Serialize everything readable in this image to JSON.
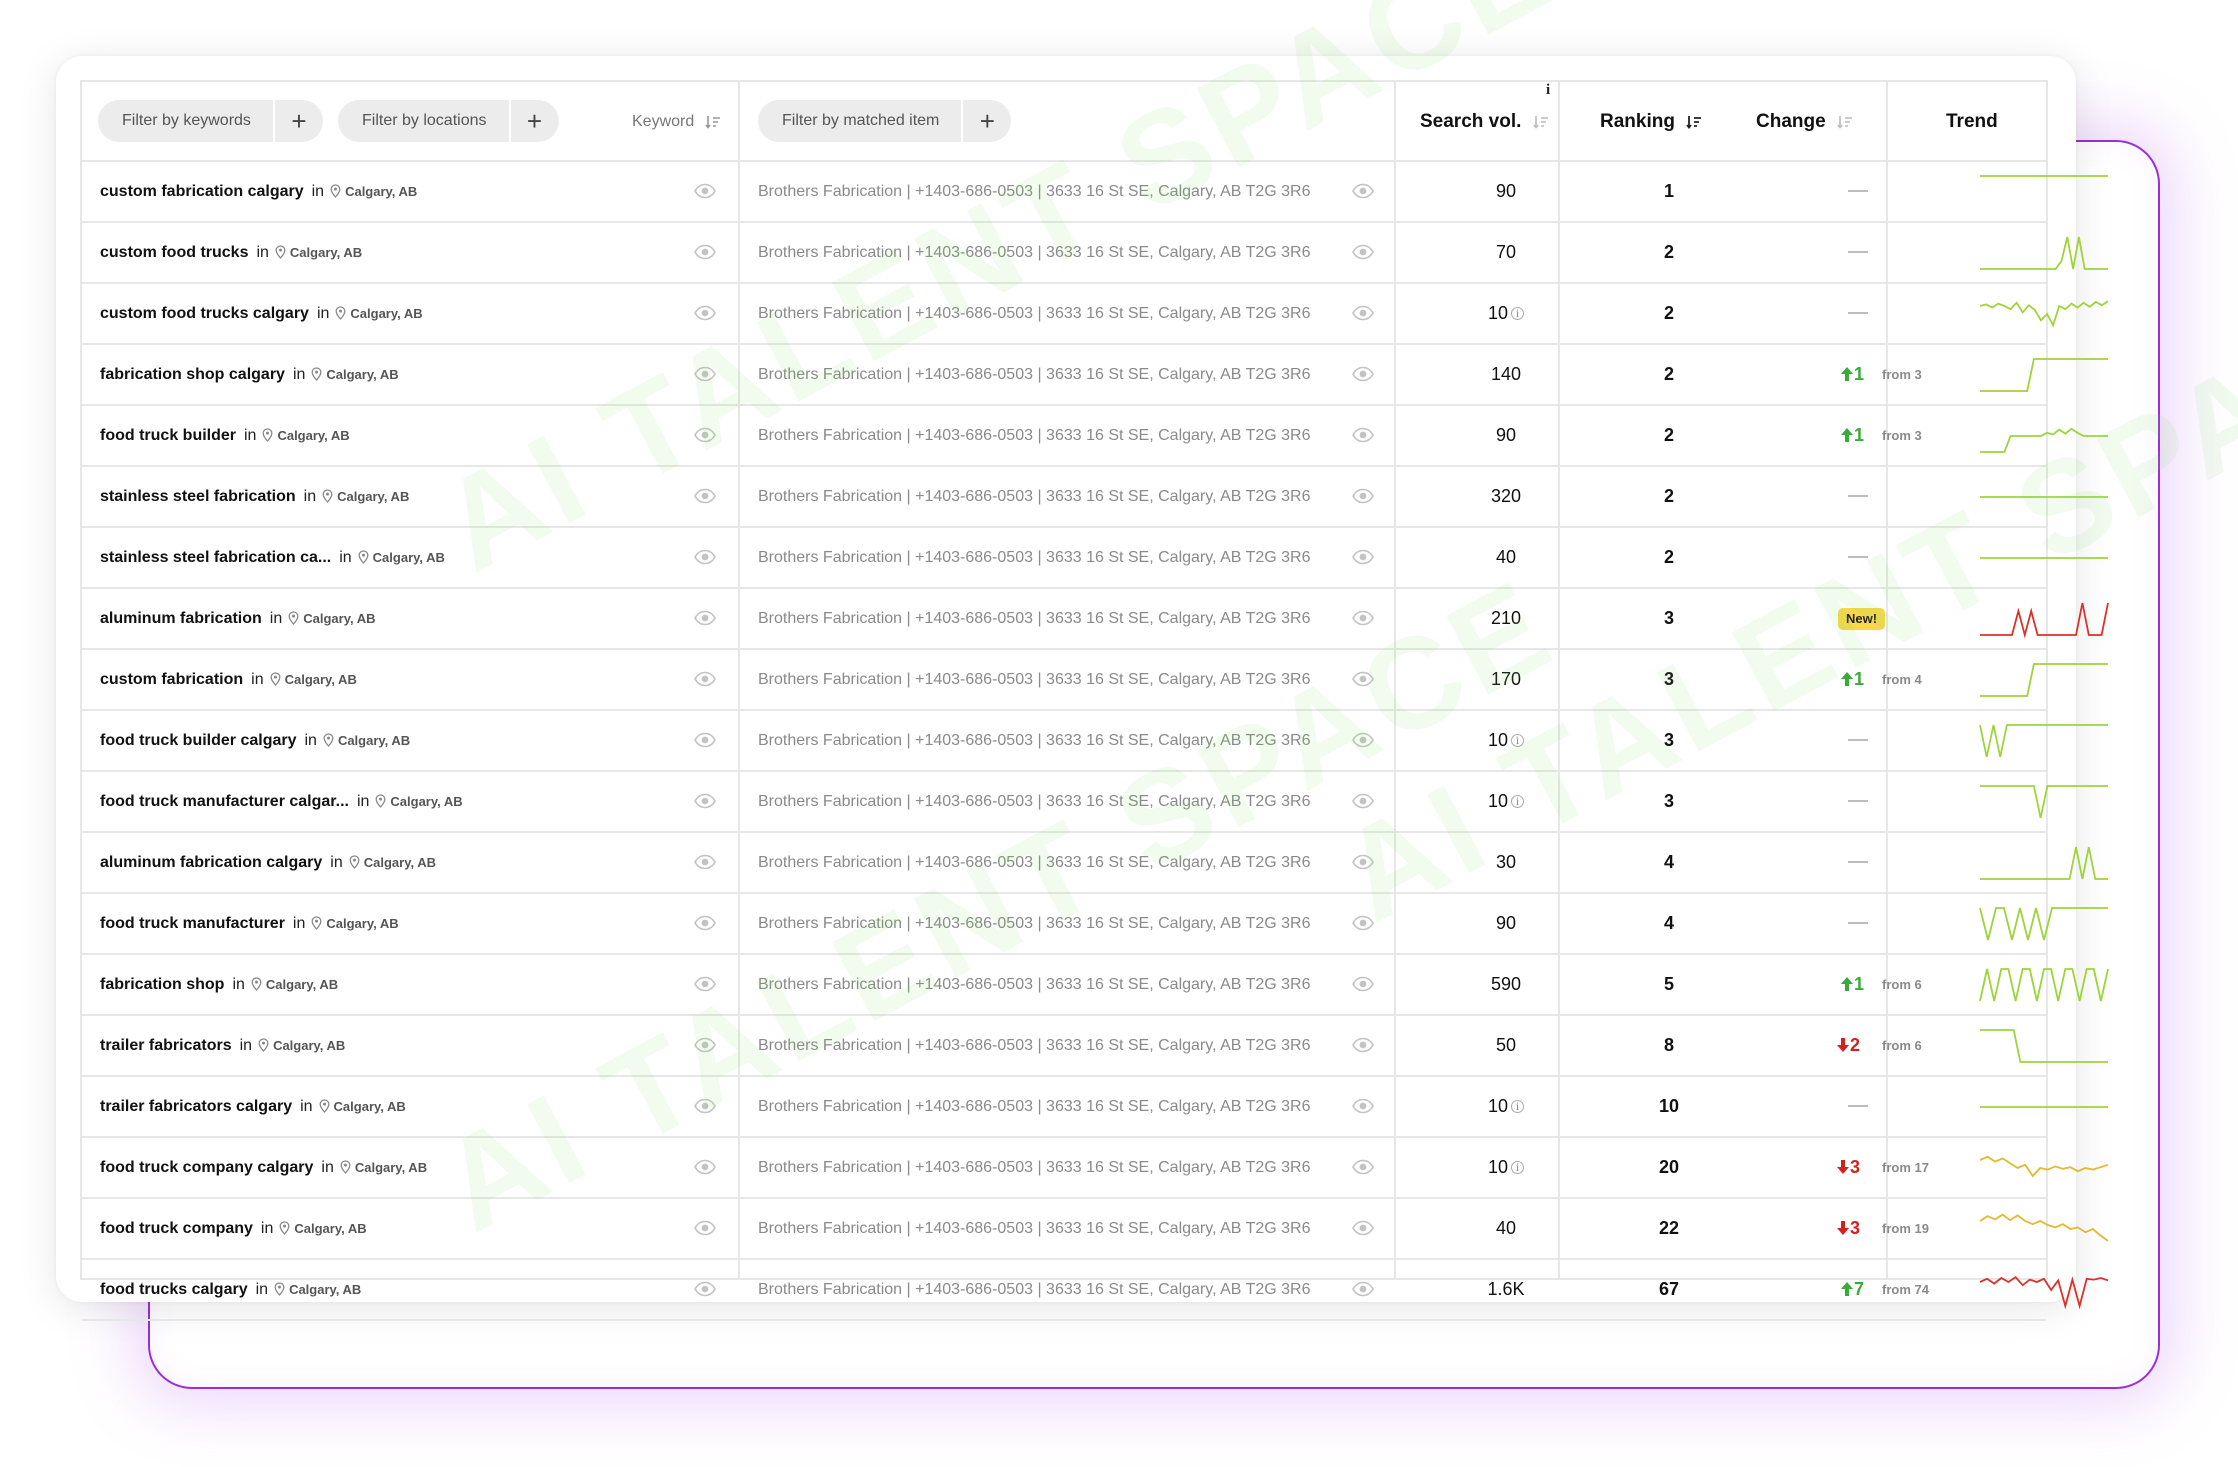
{
  "watermark_text": "AI TALENT SPACE",
  "filters": {
    "keywords_label": "Filter by keywords",
    "locations_label": "Filter by locations",
    "matched_label": "Filter by matched item",
    "add_symbol": "+"
  },
  "columns": {
    "keyword": "Keyword",
    "search_vol": "Search vol.",
    "info": "i",
    "ranking": "Ranking",
    "change": "Change",
    "trend": "Trend"
  },
  "in_word": "in",
  "colors": {
    "up": "#3aaa3a",
    "down": "#d62020",
    "trend_green": "#9dd43a",
    "trend_red": "#d9322a",
    "badge": "#f7d84a",
    "accent_border": "#9b2fd6"
  },
  "rows": [
    {
      "keyword": "custom fabrication calgary",
      "location": "Calgary, AB",
      "matched": "Brothers Fabrication | +1403-686-0503 | 3633 16 St SE, Calgary, AB T2G 3R6",
      "volume": "90",
      "vol_info": false,
      "ranking": "1",
      "change_type": "none",
      "change_value": "",
      "change_from": "",
      "trend_color": "green",
      "trend": [
        5,
        5,
        5,
        5,
        5,
        5,
        5,
        5,
        5,
        5,
        5,
        5,
        5,
        5,
        5,
        5,
        5,
        5,
        5,
        5
      ]
    },
    {
      "keyword": "custom food trucks",
      "location": "Calgary, AB",
      "matched": "Brothers Fabrication | +1403-686-0503 | 3633 16 St SE, Calgary, AB T2G 3R6",
      "volume": "70",
      "vol_info": false,
      "ranking": "2",
      "change_type": "none",
      "change_value": "",
      "change_from": "",
      "trend_color": "green",
      "trend": [
        1,
        1,
        1,
        1,
        1,
        1,
        1,
        1,
        1,
        1,
        1,
        1,
        1,
        1,
        2,
        5,
        1,
        5,
        1,
        1,
        1,
        1,
        1
      ]
    },
    {
      "keyword": "custom food trucks calgary",
      "location": "Calgary, AB",
      "matched": "Brothers Fabrication | +1403-686-0503 | 3633 16 St SE, Calgary, AB T2G 3R6",
      "volume": "10",
      "vol_info": true,
      "ranking": "2",
      "change_type": "none",
      "change_value": "",
      "change_from": "",
      "trend_color": "green",
      "trend": [
        4,
        4.2,
        3.8,
        4.3,
        4,
        3.6,
        4.4,
        3.2,
        4.1,
        3.5,
        2.2,
        3,
        1.6,
        4,
        3.6,
        4.3,
        3.8,
        4.4,
        3.9,
        4.5,
        4.1,
        4.6
      ]
    },
    {
      "keyword": "fabrication shop calgary",
      "location": "Calgary, AB",
      "matched": "Brothers Fabrication | +1403-686-0503 | 3633 16 St SE, Calgary, AB T2G 3R6",
      "volume": "140",
      "vol_info": false,
      "ranking": "2",
      "change_type": "up",
      "change_value": "1",
      "change_from": "from 3",
      "trend_color": "green",
      "trend": [
        1,
        1,
        1,
        1,
        1,
        1,
        1,
        1,
        5,
        5,
        5,
        5,
        5,
        5,
        5,
        5,
        5,
        5,
        5,
        5
      ]
    },
    {
      "keyword": "food truck builder",
      "location": "Calgary, AB",
      "matched": "Brothers Fabrication | +1403-686-0503 | 3633 16 St SE, Calgary, AB T2G 3R6",
      "volume": "90",
      "vol_info": false,
      "ranking": "2",
      "change_type": "up",
      "change_value": "1",
      "change_from": "from 3",
      "trend_color": "green",
      "trend": [
        1,
        1,
        1,
        1,
        1,
        3,
        3,
        3,
        3,
        3,
        3,
        3.4,
        3.2,
        3.8,
        3.3,
        3.9,
        3.4,
        3,
        3,
        3,
        3,
        3
      ]
    },
    {
      "keyword": "stainless steel fabrication",
      "location": "Calgary, AB",
      "matched": "Brothers Fabrication | +1403-686-0503 | 3633 16 St SE, Calgary, AB T2G 3R6",
      "volume": "320",
      "vol_info": false,
      "ranking": "2",
      "change_type": "none",
      "change_value": "",
      "change_from": "",
      "trend_color": "green",
      "trend": [
        3,
        3,
        3,
        3,
        3,
        3,
        3,
        3,
        3,
        3,
        3,
        3,
        3,
        3,
        3,
        3,
        3,
        3,
        3,
        3
      ]
    },
    {
      "keyword": "stainless steel fabrication ca...",
      "location": "Calgary, AB",
      "matched": "Brothers Fabrication | +1403-686-0503 | 3633 16 St SE, Calgary, AB T2G 3R6",
      "volume": "40",
      "vol_info": false,
      "ranking": "2",
      "change_type": "none",
      "change_value": "",
      "change_from": "",
      "trend_color": "green",
      "trend": [
        3,
        3,
        3,
        3,
        3,
        3,
        3,
        3,
        3,
        3,
        3,
        3,
        3,
        3,
        3,
        3,
        3,
        3,
        3,
        3
      ]
    },
    {
      "keyword": "aluminum fabrication",
      "location": "Calgary, AB",
      "matched": "Brothers Fabrication | +1403-686-0503 | 3633 16 St SE, Calgary, AB T2G 3R6",
      "volume": "210",
      "vol_info": false,
      "ranking": "3",
      "change_type": "new",
      "change_value": "New!",
      "change_from": "",
      "trend_color": "red",
      "trend": [
        1,
        1,
        1,
        1,
        1,
        1,
        4,
        1,
        4,
        1,
        1,
        1,
        1,
        1,
        1,
        1,
        5,
        1,
        1,
        1,
        5
      ]
    },
    {
      "keyword": "custom fabrication",
      "location": "Calgary, AB",
      "matched": "Brothers Fabrication | +1403-686-0503 | 3633 16 St SE, Calgary, AB T2G 3R6",
      "volume": "170",
      "vol_info": false,
      "ranking": "3",
      "change_type": "up",
      "change_value": "1",
      "change_from": "from 4",
      "trend_color": "green",
      "trend": [
        1,
        1,
        1,
        1,
        1,
        1,
        1,
        1,
        5,
        5,
        5,
        5,
        5,
        5,
        5,
        5,
        5,
        5,
        5,
        5
      ]
    },
    {
      "keyword": "food truck builder calgary",
      "location": "Calgary, AB",
      "matched": "Brothers Fabrication | +1403-686-0503 | 3633 16 St SE, Calgary, AB T2G 3R6",
      "volume": "10",
      "vol_info": true,
      "ranking": "3",
      "change_type": "none",
      "change_value": "",
      "change_from": "",
      "trend_color": "green",
      "trend": [
        5,
        1,
        5,
        1,
        5,
        5,
        5,
        5,
        5,
        5,
        5,
        5,
        5,
        5,
        5,
        5,
        5,
        5,
        5,
        5
      ]
    },
    {
      "keyword": "food truck manufacturer calgar...",
      "location": "Calgary, AB",
      "matched": "Brothers Fabrication | +1403-686-0503 | 3633 16 St SE, Calgary, AB T2G 3R6",
      "volume": "10",
      "vol_info": true,
      "ranking": "3",
      "change_type": "none",
      "change_value": "",
      "change_from": "",
      "trend_color": "green",
      "trend": [
        5,
        5,
        5,
        5,
        5,
        5,
        5,
        5,
        5,
        1,
        5,
        5,
        5,
        5,
        5,
        5,
        5,
        5,
        5,
        5
      ]
    },
    {
      "keyword": "aluminum fabrication calgary",
      "location": "Calgary, AB",
      "matched": "Brothers Fabrication | +1403-686-0503 | 3633 16 St SE, Calgary, AB T2G 3R6",
      "volume": "30",
      "vol_info": false,
      "ranking": "4",
      "change_type": "none",
      "change_value": "",
      "change_from": "",
      "trend_color": "green",
      "trend": [
        1,
        1,
        1,
        1,
        1,
        1,
        1,
        1,
        1,
        1,
        1,
        1,
        1,
        1,
        1,
        5,
        1,
        5,
        1,
        1,
        1
      ]
    },
    {
      "keyword": "food truck manufacturer",
      "location": "Calgary, AB",
      "matched": "Brothers Fabrication | +1403-686-0503 | 3633 16 St SE, Calgary, AB T2G 3R6",
      "volume": "90",
      "vol_info": false,
      "ranking": "4",
      "change_type": "none",
      "change_value": "",
      "change_from": "",
      "trend_color": "green",
      "trend": [
        5,
        1,
        5,
        5,
        1,
        5,
        1,
        5,
        1,
        5,
        5,
        5,
        5,
        5,
        5,
        5,
        5
      ]
    },
    {
      "keyword": "fabrication shop",
      "location": "Calgary, AB",
      "matched": "Brothers Fabrication | +1403-686-0503 | 3633 16 St SE, Calgary, AB T2G 3R6",
      "volume": "590",
      "vol_info": false,
      "ranking": "5",
      "change_type": "up",
      "change_value": "1",
      "change_from": "from 6",
      "trend_color": "green",
      "trend": [
        1,
        5,
        1,
        5,
        5,
        1,
        5,
        5,
        1,
        5,
        5,
        1,
        5,
        5,
        1,
        5,
        5,
        1,
        5
      ]
    },
    {
      "keyword": "trailer fabricators",
      "location": "Calgary, AB",
      "matched": "Brothers Fabrication | +1403-686-0503 | 3633 16 St SE, Calgary, AB T2G 3R6",
      "volume": "50",
      "vol_info": false,
      "ranking": "8",
      "change_type": "down",
      "change_value": "2",
      "change_from": "from 6",
      "trend_color": "green",
      "trend": [
        5,
        5,
        5,
        5,
        5,
        5,
        1,
        1,
        1,
        1,
        1,
        1,
        1,
        1,
        1,
        1,
        1,
        1,
        1,
        1
      ]
    },
    {
      "keyword": "trailer fabricators calgary",
      "location": "Calgary, AB",
      "matched": "Brothers Fabrication | +1403-686-0503 | 3633 16 St SE, Calgary, AB T2G 3R6",
      "volume": "10",
      "vol_info": true,
      "ranking": "10",
      "change_type": "none",
      "change_value": "",
      "change_from": "",
      "trend_color": "green",
      "trend": [
        3,
        3,
        3,
        3,
        3,
        3,
        3,
        3,
        3,
        3,
        3,
        3,
        3,
        3,
        3,
        3,
        3,
        3,
        3,
        3
      ]
    },
    {
      "keyword": "food truck company calgary",
      "location": "Calgary, AB",
      "matched": "Brothers Fabrication | +1403-686-0503 | 3633 16 St SE, Calgary, AB T2G 3R6",
      "volume": "10",
      "vol_info": true,
      "ranking": "20",
      "change_type": "down",
      "change_value": "3",
      "change_from": "from 17",
      "trend_color": "yellow",
      "trend": [
        4,
        4.4,
        3.8,
        4.2,
        3.6,
        3,
        3.4,
        2,
        3,
        2.8,
        3.2,
        2.9,
        3.1,
        2.6,
        3,
        2.8,
        3.1,
        3.4
      ]
    },
    {
      "keyword": "food truck company",
      "location": "Calgary, AB",
      "matched": "Brothers Fabrication | +1403-686-0503 | 3633 16 St SE, Calgary, AB T2G 3R6",
      "volume": "40",
      "vol_info": false,
      "ranking": "22",
      "change_type": "down",
      "change_value": "3",
      "change_from": "from 19",
      "trend_color": "yellow",
      "trend": [
        4,
        4.6,
        4.2,
        4.8,
        4.1,
        4.7,
        4,
        3.6,
        4,
        3.5,
        3.2,
        3.6,
        3,
        3.2,
        2.6,
        3,
        2.2,
        1.5
      ]
    },
    {
      "keyword": "food trucks calgary",
      "location": "Calgary, AB",
      "matched": "Brothers Fabrication | +1403-686-0503 | 3633 16 St SE, Calgary, AB T2G 3R6",
      "volume": "1.6K",
      "vol_info": false,
      "ranking": "67",
      "change_type": "up",
      "change_value": "7",
      "change_from": "from 74",
      "trend_color": "red",
      "trend": [
        4,
        4.4,
        3.8,
        4.5,
        4,
        4.6,
        3.6,
        4.3,
        4,
        4.4,
        3,
        4.2,
        1,
        4.3,
        1,
        4.4,
        4.3,
        4.5,
        4.2
      ]
    }
  ]
}
